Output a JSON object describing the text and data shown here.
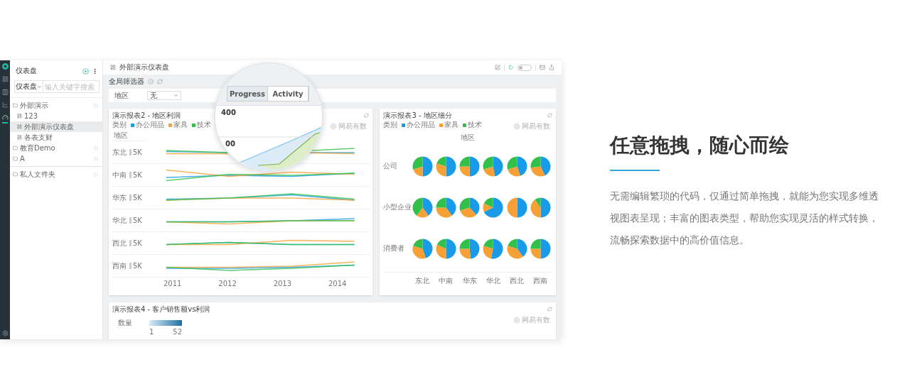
{
  "sidebar": {
    "title": "仪表盘",
    "search": {
      "scope": "仪表盘",
      "placeholder": "输入关键字搜索"
    },
    "tree": [
      {
        "label": "外部演示",
        "kind": "folder",
        "selected": false,
        "children": [
          {
            "label": "123",
            "kind": "dashboard",
            "selected": false
          },
          {
            "label": "外部演示仪表盘",
            "kind": "dashboard",
            "selected": true
          },
          {
            "label": "各表支财",
            "kind": "dashboard",
            "selected": false
          }
        ]
      },
      {
        "label": "教育Demo",
        "kind": "folder",
        "selected": false
      },
      {
        "label": "A",
        "kind": "folder",
        "selected": false
      }
    ],
    "private": [
      {
        "label": "私人文件夹",
        "kind": "folder",
        "selected": false
      }
    ]
  },
  "dashboard": {
    "title": "外部演示仪表盘",
    "play_toggle": {
      "on": false
    }
  },
  "filters": {
    "title": "全局筛选器",
    "items": [
      {
        "label": "地区",
        "value": "无"
      }
    ]
  },
  "magnifier": {
    "tabs": [
      {
        "label": "Progress",
        "selected": true
      },
      {
        "label": "Activity",
        "selected": false
      }
    ],
    "ticks": [
      "400",
      "00"
    ]
  },
  "cards": [
    {
      "kind": "lines",
      "title": "演示报表2 - 地区利润",
      "watermark": "网易有数",
      "legend_title": "类别",
      "legend": [
        {
          "label": "办公用品",
          "color": "#1a9be8"
        },
        {
          "label": "家具",
          "color": "#f7a035"
        },
        {
          "label": "技术",
          "color": "#33c04a"
        }
      ],
      "row_header": "地区",
      "rows": [
        {
          "label": "东北",
          "tick": "5K"
        },
        {
          "label": "中南",
          "tick": "5K"
        },
        {
          "label": "华东",
          "tick": "5K"
        },
        {
          "label": "华北",
          "tick": "5K"
        },
        {
          "label": "西北",
          "tick": "5K"
        },
        {
          "label": "西南",
          "tick": "5K"
        }
      ],
      "x_labels": [
        "2011",
        "2012",
        "2013",
        "2014"
      ]
    },
    {
      "kind": "pies",
      "title": "演示报表3 - 地区细分",
      "watermark": "网易有数",
      "legend_title": "类别",
      "legend": [
        {
          "label": "办公用品",
          "color": "#1a9be8"
        },
        {
          "label": "家具",
          "color": "#f7a035"
        },
        {
          "label": "技术",
          "color": "#33c04a"
        }
      ],
      "column_header": "地区",
      "rows": [
        "公司",
        "小型企业",
        "消费者"
      ],
      "columns": [
        "东北",
        "中南",
        "华东",
        "华北",
        "西北",
        "西南"
      ]
    },
    {
      "kind": "heat",
      "title": "演示报表4 - 客户销售额vs利润",
      "watermark": "网易有数",
      "legend_title": "数量",
      "min": "1",
      "max": "52"
    }
  ],
  "feature": {
    "headline": "任意拖拽，随心而绘",
    "body": "无需编辑繁琐的代码，仅通过简单拖拽，就能为您实现多维透视图表呈现；丰富的图表类型，帮助您实现灵活的样式转换，流畅探索数据中的高价值信息。"
  }
}
